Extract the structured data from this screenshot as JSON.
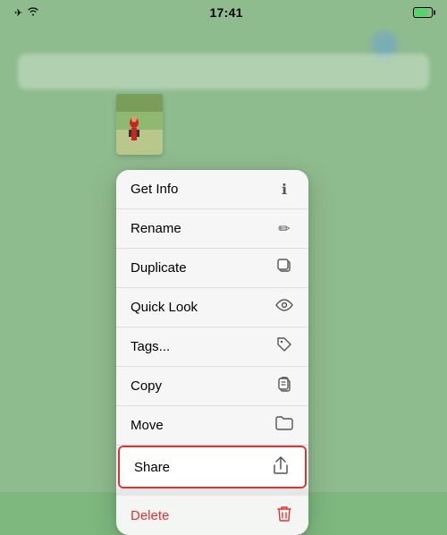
{
  "statusBar": {
    "time": "17:41",
    "batteryColor": "#4cd964"
  },
  "contextMenu": {
    "items": [
      {
        "id": "get-info",
        "label": "Get Info",
        "icon": "ℹ"
      },
      {
        "id": "rename",
        "label": "Rename",
        "icon": "✏"
      },
      {
        "id": "duplicate",
        "label": "Duplicate",
        "icon": "⧉"
      },
      {
        "id": "quick-look",
        "label": "Quick Look",
        "icon": "👁"
      },
      {
        "id": "tags",
        "label": "Tags...",
        "icon": "⌑"
      },
      {
        "id": "copy",
        "label": "Copy",
        "icon": "📋"
      },
      {
        "id": "move",
        "label": "Move",
        "icon": "🗂"
      },
      {
        "id": "share",
        "label": "Share",
        "icon": "⬆",
        "highlighted": true
      },
      {
        "id": "delete",
        "label": "Delete",
        "icon": "🗑",
        "danger": true
      }
    ]
  }
}
